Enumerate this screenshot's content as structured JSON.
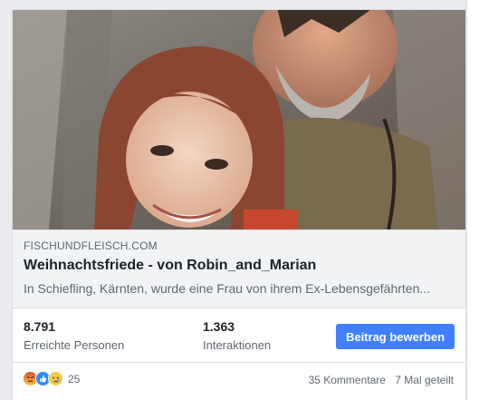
{
  "link_preview": {
    "domain": "FISCHUNDFLEISCH.COM",
    "title": "Weihnachtsfriede - von Robin_and_Marian",
    "description": "In Schiefling, Kärnten, wurde eine Frau von ihrem Ex-Lebensgefährten..."
  },
  "stats": {
    "reach_value": "8.791",
    "reach_label": "Erreichte Personen",
    "engagement_value": "1.363",
    "engagement_label": "Interaktionen",
    "boost_label": "Beitrag bewerben"
  },
  "footer": {
    "reaction_icons": [
      "angry-icon",
      "like-icon",
      "sad-icon"
    ],
    "reaction_count": "25",
    "comments": "35 Kommentare",
    "shares": "7 Mal geteilt"
  },
  "colors": {
    "accent": "#4080ff",
    "link_bg": "#f2f3f5",
    "text_primary": "#1d2129",
    "text_secondary": "#606770"
  }
}
